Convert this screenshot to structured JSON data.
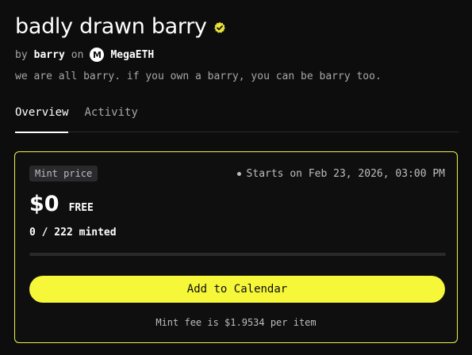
{
  "header": {
    "title": "badly drawn barry",
    "verified_icon": "verified-badge-icon",
    "by_label": "by",
    "creator": "barry",
    "on_label": "on",
    "chain_logo_letter": "M",
    "chain": "MegaETH",
    "description": "we are all barry. if you own a barry, you can be barry too."
  },
  "tabs": [
    {
      "label": "Overview",
      "active": true
    },
    {
      "label": "Activity",
      "active": false
    }
  ],
  "mint": {
    "badge": "Mint price",
    "starts": "Starts on Feb 23, 2026, 03:00 PM",
    "price": "$0",
    "price_note": "FREE",
    "minted_text": "0 / 222 minted",
    "minted": 0,
    "supply": 222,
    "cta_label": "Add to Calendar",
    "fee_text": "Mint fee is $1.9534 per item"
  },
  "colors": {
    "accent": "#f7f73a",
    "background": "#0d0d0e",
    "verified": "#e8e23a"
  }
}
